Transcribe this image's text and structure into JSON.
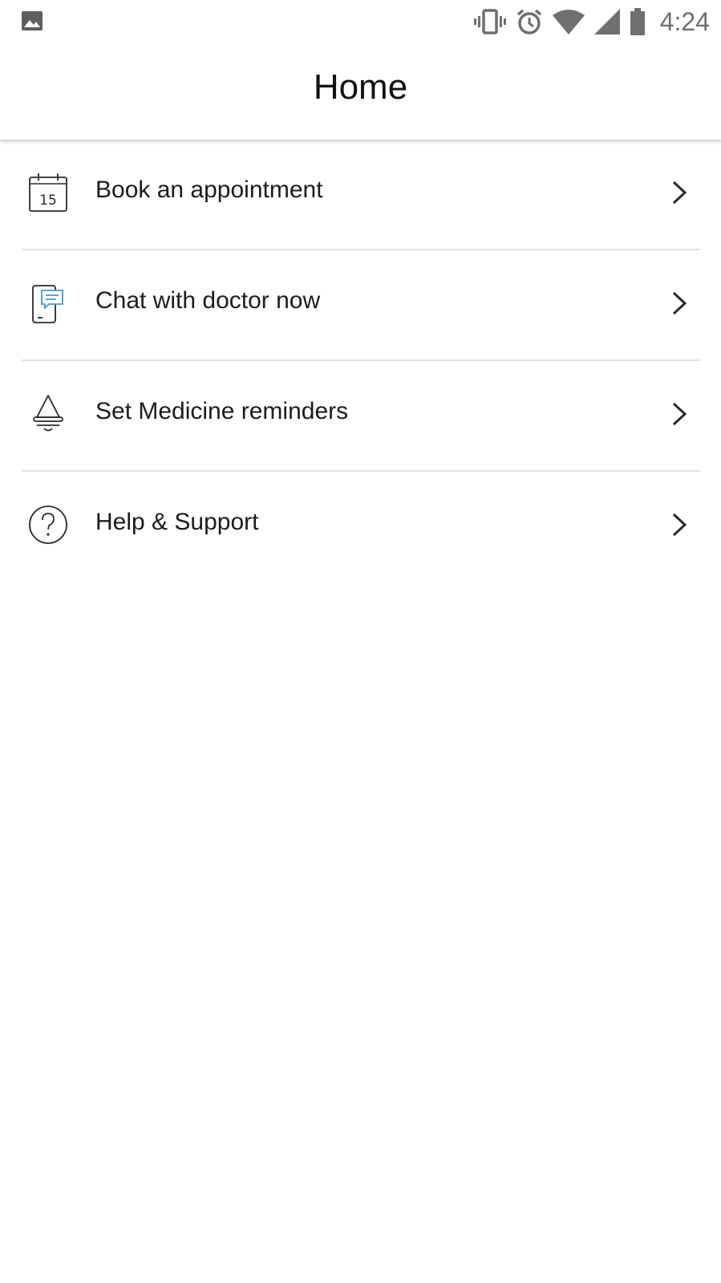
{
  "status_bar": {
    "time": "4:24",
    "icons": [
      "image-icon",
      "vibrate-icon",
      "alarm-icon",
      "wifi-icon",
      "signal-icon",
      "battery-icon"
    ]
  },
  "app_bar": {
    "title": "Home"
  },
  "menu": {
    "items": [
      {
        "label": "Book an appointment",
        "icon": "calendar-icon",
        "calendar_day": "15"
      },
      {
        "label": "Chat with doctor now",
        "icon": "phone-chat-icon"
      },
      {
        "label": "Set Medicine reminders",
        "icon": "bell-icon"
      },
      {
        "label": "Help & Support",
        "icon": "help-circle-icon"
      }
    ]
  },
  "colors": {
    "text": "#1c1c1c",
    "divider": "#e0e0e0",
    "status_icons": "#6f6f6f",
    "chat_accent": "#3a9fd4"
  }
}
